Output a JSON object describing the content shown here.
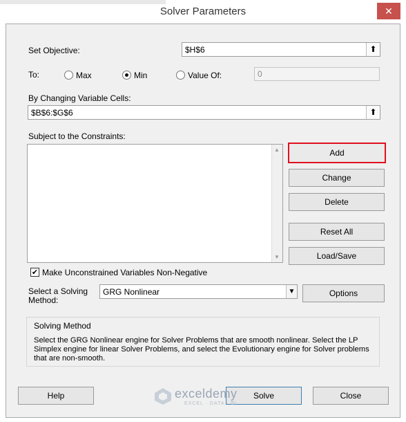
{
  "window": {
    "title": "Solver Parameters",
    "close_glyph": "✕"
  },
  "objective": {
    "label": "Set Objective:",
    "value": "$H$6"
  },
  "to": {
    "label": "To:",
    "options": [
      {
        "label": "Max",
        "checked": false
      },
      {
        "label": "Min",
        "checked": true
      },
      {
        "label": "Value Of:",
        "checked": false
      }
    ],
    "value_of": "0"
  },
  "variables": {
    "label": "By Changing Variable Cells:",
    "value": "$B$6:$G$6"
  },
  "constraints": {
    "label": "Subject to the Constraints:",
    "items": []
  },
  "buttons": {
    "add": "Add",
    "change": "Change",
    "delete": "Delete",
    "reset_all": "Reset All",
    "load_save": "Load/Save",
    "options": "Options",
    "help": "Help",
    "solve": "Solve",
    "close": "Close"
  },
  "nonneg": {
    "label": "Make Unconstrained Variables Non-Negative",
    "checked": true,
    "check_glyph": "✔"
  },
  "method": {
    "label_line1": "Select a Solving",
    "label_line2": "Method:",
    "selected": "GRG Nonlinear"
  },
  "solving_method": {
    "title": "Solving Method",
    "text": "Select the GRG Nonlinear engine for Solver Problems that are smooth nonlinear. Select the LP Simplex engine for linear Solver Problems, and select the Evolutionary engine for Solver problems that are non-smooth."
  },
  "watermark": {
    "name": "exceldemy",
    "sub": "EXCEL · DATA · BI"
  },
  "icons": {
    "ref": "⬆",
    "dropdown": "▼",
    "scroll_up": "▲",
    "scroll_down": "▼"
  },
  "colors": {
    "highlight": "#e0101e",
    "close": "#c7514c"
  }
}
